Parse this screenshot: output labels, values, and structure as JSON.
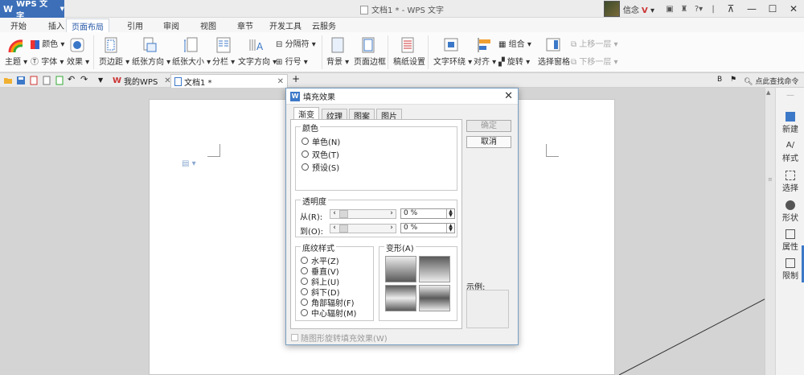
{
  "app": {
    "menu_label": "WPS 文字",
    "doc_title": "文档1 * - WPS 文字",
    "user": "信念",
    "user_suffix": "V",
    "help": "?"
  },
  "tabs": [
    "开始",
    "插入",
    "页面布局",
    "引用",
    "审阅",
    "视图",
    "章节",
    "开发工具",
    "云服务"
  ],
  "active_tab": "页面布局",
  "ribbon": {
    "theme": "主题",
    "color": "颜色",
    "font": "字体",
    "effect": "效果",
    "margins": "页边距",
    "orientation": "纸张方向",
    "size": "纸张大小",
    "columns": "分栏",
    "text_direction": "文字方向",
    "breaks": "分隔符",
    "line_numbers": "行号",
    "background": "背景",
    "page_border": "页面边框",
    "manuscript": "稿纸设置",
    "text_wrap": "文字环绕",
    "align": "对齐",
    "rotate": "旋转",
    "group": "组合",
    "selection_pane": "选择窗格",
    "bring_forward": "上移一层",
    "send_backward": "下移一层"
  },
  "doc_tabs": {
    "home": "我的WPS",
    "doc": "文档1 *",
    "search": "点此查找命令"
  },
  "sidebar": [
    "新建",
    "样式",
    "选择",
    "形状",
    "属性",
    "限制"
  ],
  "dialog": {
    "title": "填充效果",
    "tabs": [
      "渐变",
      "纹理",
      "图案",
      "图片"
    ],
    "color_group": "颜色",
    "color_options": [
      "单色(N)",
      "双色(T)",
      "预设(S)"
    ],
    "transparency_group": "透明度",
    "from_label": "从(R):",
    "to_label": "到(O):",
    "from_value": "0 %",
    "to_value": "0 %",
    "shading_group": "底纹样式",
    "shading_options": [
      "水平(Z)",
      "垂直(V)",
      "斜上(U)",
      "斜下(D)",
      "角部辐射(F)",
      "中心辐射(M)"
    ],
    "variants_group": "变形(A)",
    "ok": "确定",
    "cancel": "取消",
    "sample": "示例:",
    "rotate_with_shape": "随图形旋转填充效果(W)"
  }
}
